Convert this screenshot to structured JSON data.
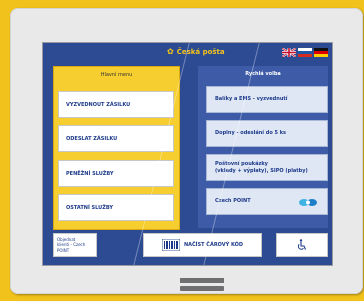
{
  "header": {
    "brand_name": "Česká pošta",
    "languages": [
      "en",
      "ru",
      "de"
    ]
  },
  "main_menu": {
    "title": "Hlavní menu",
    "items": [
      {
        "label": "VYZVEDNOUT ZÁSILKU"
      },
      {
        "label": "ODESLAT ZÁSILKU"
      },
      {
        "label": "PENĚŽNÍ SLUŽBY"
      },
      {
        "label": "OSTATNÍ SLUŽBY"
      }
    ]
  },
  "quick_choice": {
    "title": "Rychlá volba",
    "items": [
      {
        "label": "Balíky a EMS - vyzvednutí"
      },
      {
        "label": "Doplny - odeslání do 5 ks"
      },
      {
        "label_line1": "Poštovní poukázky",
        "label_line2": "(vklady + výplaty), SIPO (platby)"
      },
      {
        "label": "Czech POINT"
      }
    ]
  },
  "bottom_bar": {
    "order_line1": "Objednat",
    "order_line2": "klienti - Czech POINT",
    "barcode_label": "NAČÍST ČÁROVÝ KÓD",
    "accessibility_icon": "wheelchair-icon"
  },
  "colors": {
    "kiosk_yellow": "#f2c21c",
    "screen_blue": "#2d4b93",
    "menu_yellow": "#f6ce2f",
    "text_blue": "#1d3a8a"
  }
}
